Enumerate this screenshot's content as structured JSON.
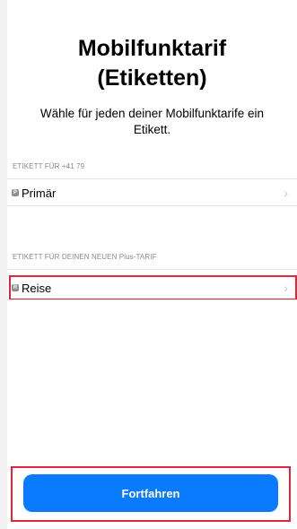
{
  "header": {
    "title_line1": "Mobilfunktarif",
    "title_line2": "(Etiketten)",
    "subtitle": "Wähle für jeden deiner Mobilfunktarife ein Etikett."
  },
  "sections": [
    {
      "header": "ETIKETT FÜR +41 79",
      "row": {
        "badge": "P",
        "label": "Primär"
      }
    },
    {
      "header": "ETIKETT FÜR DEINEN NEUEN Plus-TARIF",
      "row": {
        "badge": "R",
        "label": "Reise"
      }
    }
  ],
  "footer": {
    "continue_label": "Fortfahren"
  },
  "colors": {
    "accent": "#0a7aff",
    "highlight": "#e0263c"
  }
}
